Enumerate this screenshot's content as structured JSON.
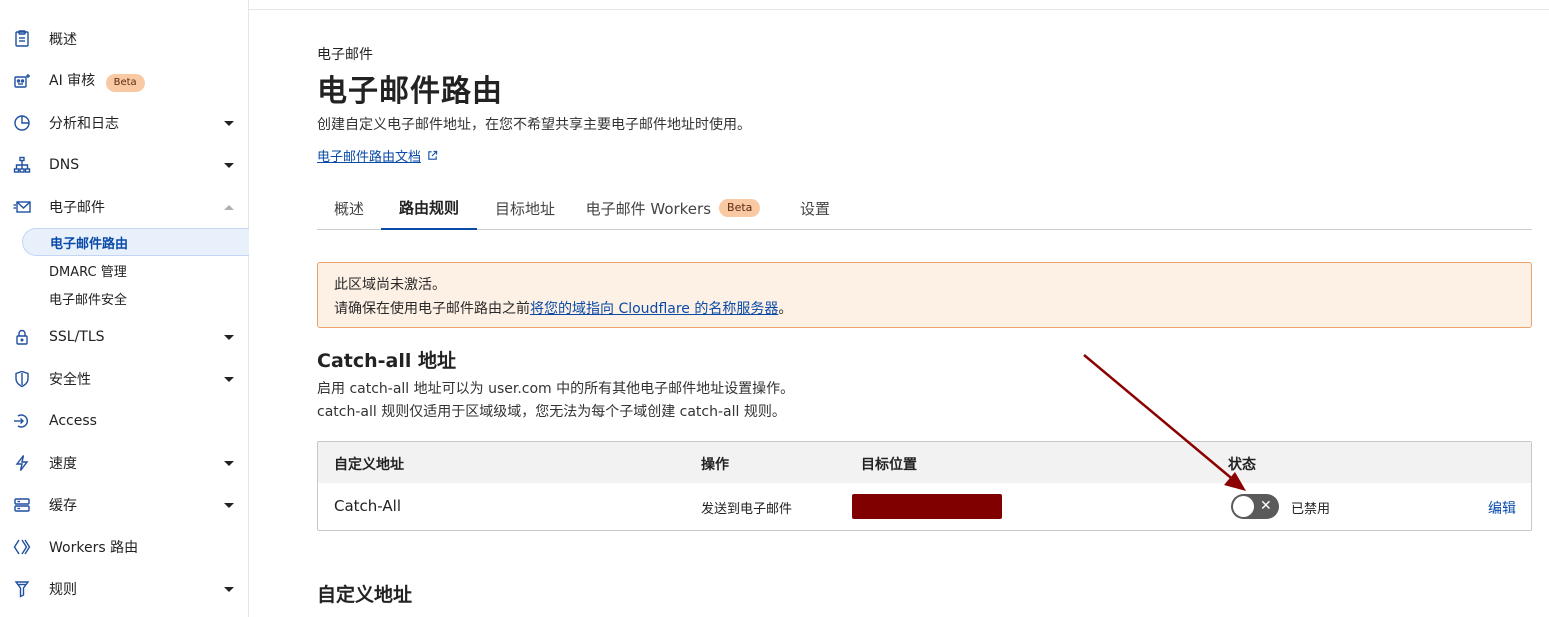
{
  "sidebar": {
    "items": [
      {
        "label": "概述",
        "icon": "document-icon"
      },
      {
        "label": "AI 审核",
        "icon": "robot-icon",
        "badge": "Beta"
      },
      {
        "label": "分析和日志",
        "icon": "pie-chart-icon"
      },
      {
        "label": "DNS",
        "icon": "network-icon"
      },
      {
        "label": "电子邮件",
        "icon": "email-icon"
      },
      {
        "label": "SSL/TLS",
        "icon": "lock-icon"
      },
      {
        "label": "安全性",
        "icon": "shield-icon"
      },
      {
        "label": "Access",
        "icon": "access-icon"
      },
      {
        "label": "速度",
        "icon": "lightning-icon"
      },
      {
        "label": "缓存",
        "icon": "server-icon"
      },
      {
        "label": "Workers 路由",
        "icon": "workers-icon"
      },
      {
        "label": "规则",
        "icon": "filter-icon"
      }
    ],
    "email_sub": [
      "电子邮件路由",
      "DMARC 管理",
      "电子邮件安全"
    ]
  },
  "header": {
    "eyebrow": "电子邮件",
    "title": "电子邮件路由",
    "description": "创建自定义电子邮件地址，在您不希望共享主要电子邮件地址时使用。",
    "doc_link": "电子邮件路由文档"
  },
  "tabs": [
    {
      "label": "概述"
    },
    {
      "label": "路由规则",
      "active": true
    },
    {
      "label": "目标地址"
    },
    {
      "label": "电子邮件 Workers",
      "badge": "Beta"
    },
    {
      "label": "设置"
    }
  ],
  "alert": {
    "line1": "此区域尚未激活。",
    "line2_prefix": "请确保在使用电子邮件路由之前",
    "line2_link": "将您的域指向 Cloudflare 的名称服务器",
    "line2_suffix": "。"
  },
  "catch_all": {
    "title": "Catch-all 地址",
    "desc1": "启用 catch-all 地址可以为 user.com 中的所有其他电子邮件地址设置操作。",
    "desc2": "catch-all 规则仅适用于区域级域，您无法为每个子域创建 catch-all 规则。",
    "columns": [
      "自定义地址",
      "操作",
      "目标位置",
      "状态"
    ],
    "row": {
      "address": "Catch-All",
      "action": "发送到电子邮件",
      "destination_redacted": true,
      "status": "已禁用",
      "enabled": false,
      "edit": "编辑"
    }
  },
  "custom": {
    "title": "自定义地址"
  },
  "colors": {
    "accent": "#0a4ba8",
    "alert_bg": "#fdf0e4",
    "alert_border": "#e9a26b",
    "redaction": "#800000",
    "annotation_arrow": "#8b0000"
  }
}
